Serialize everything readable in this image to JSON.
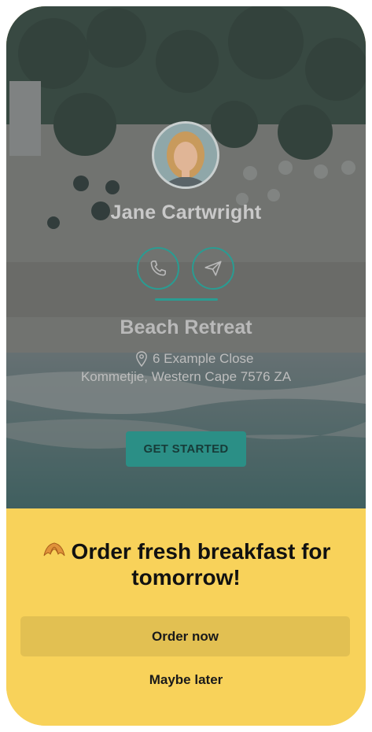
{
  "profile": {
    "name": "Jane Cartwright",
    "avatar_alt": "avatar"
  },
  "actions": {
    "call_icon": "phone-icon",
    "message_icon": "paper-plane-icon"
  },
  "property": {
    "name": "Beach Retreat",
    "address_line1": "6 Example Close",
    "address_line2": "Kommetjie, Western Cape 7576 ZA",
    "location_icon": "map-pin-icon"
  },
  "cta": {
    "get_started_label": "GET STARTED"
  },
  "promo": {
    "emoji": "croissant",
    "title": "Order fresh breakfast for tomorrow!",
    "order_label": "Order now",
    "later_label": "Maybe later"
  },
  "colors": {
    "accent": "#2a9c92",
    "sheet_bg": "#f8d25a",
    "order_button_bg": "#e2c052"
  }
}
